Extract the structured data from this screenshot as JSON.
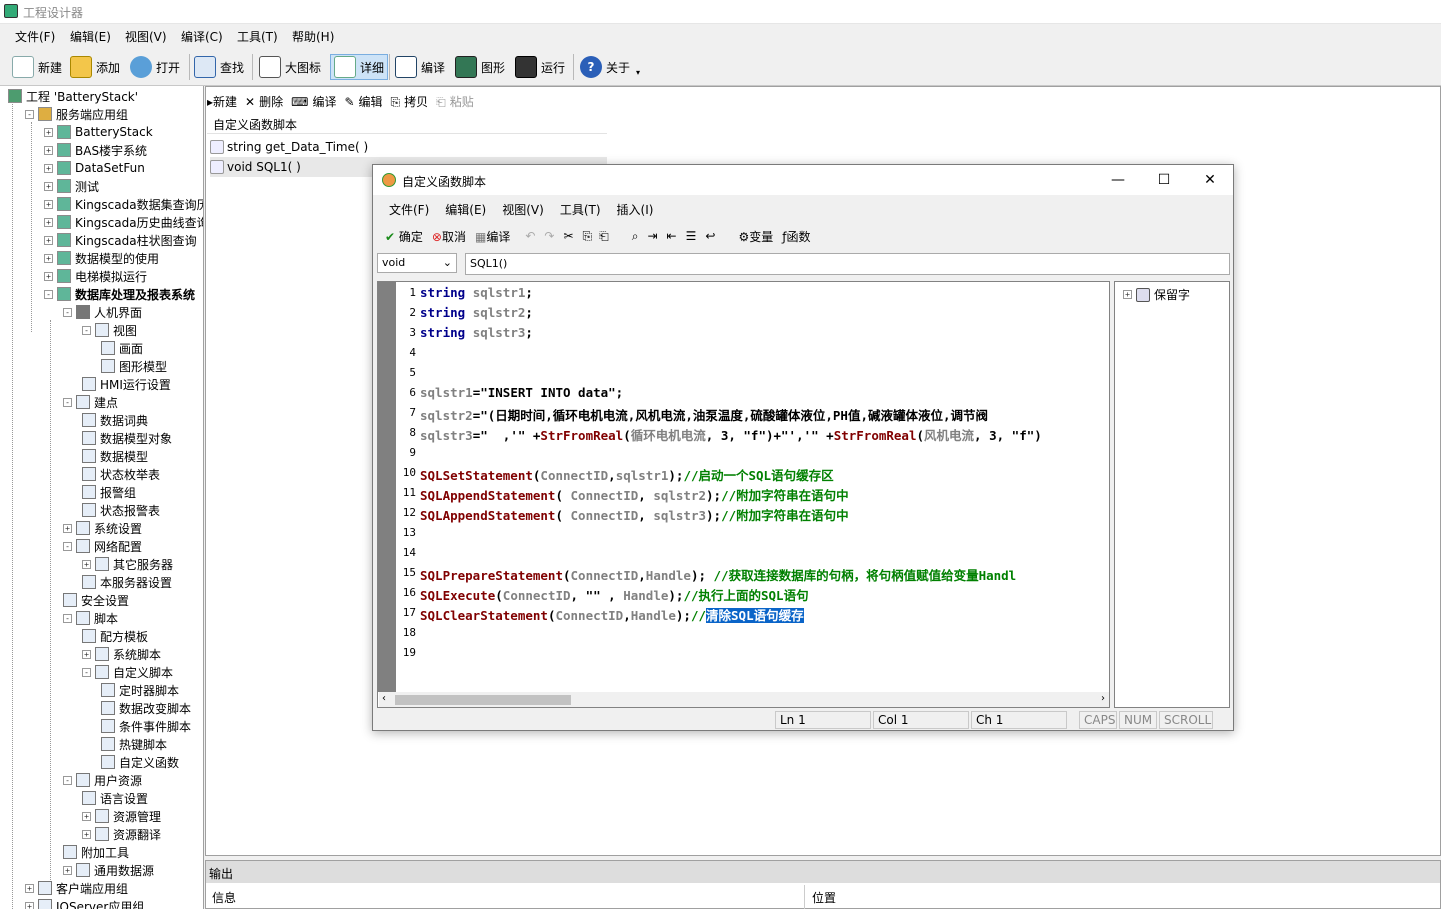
{
  "app": {
    "title": "工程设计器",
    "menus": [
      "文件(F)",
      "编辑(E)",
      "视图(V)",
      "编译(C)",
      "工具(T)",
      "帮助(H)"
    ],
    "toolbar": [
      "新建",
      "添加",
      "打开",
      "查找",
      "大图标",
      "详细",
      "编译",
      "图形",
      "运行",
      "关于"
    ]
  },
  "tree": [
    {
      "label": "工程 'BatteryStack'",
      "icon": "project-icon"
    },
    {
      "label": "服务端应用组",
      "icon": "server-group-icon"
    },
    {
      "label": "BatteryStack",
      "icon": "app-icon"
    },
    {
      "label": "BAS楼宇系统",
      "icon": "app-icon"
    },
    {
      "label": "DataSetFun",
      "icon": "app-icon"
    },
    {
      "label": "测试",
      "icon": "app-icon"
    },
    {
      "label": "Kingscada数据集查询历史",
      "icon": "app-icon"
    },
    {
      "label": "Kingscada历史曲线查询",
      "icon": "app-icon"
    },
    {
      "label": "Kingscada柱状图查询",
      "icon": "app-icon"
    },
    {
      "label": "数据模型的使用",
      "icon": "app-icon"
    },
    {
      "label": "电梯模拟运行",
      "icon": "app-icon"
    },
    {
      "label": "数据库处理及报表系统",
      "icon": "app-icon"
    },
    {
      "label": "人机界面",
      "icon": "hmi-icon"
    },
    {
      "label": "视图",
      "icon": "view-icon"
    },
    {
      "label": "画面",
      "icon": "screen-icon"
    },
    {
      "label": "图形模型",
      "icon": "graphic-model-icon"
    },
    {
      "label": "HMI运行设置",
      "icon": "settings-icon"
    },
    {
      "label": "建点",
      "icon": "tag-icon"
    },
    {
      "label": "数据词典",
      "icon": "dictionary-icon"
    },
    {
      "label": "数据模型对象",
      "icon": "model-object-icon"
    },
    {
      "label": "数据模型",
      "icon": "model-icon"
    },
    {
      "label": "状态枚举表",
      "icon": "enum-icon"
    },
    {
      "label": "报警组",
      "icon": "alarm-group-icon"
    },
    {
      "label": "状态报警表",
      "icon": "alarm-table-icon"
    },
    {
      "label": "系统设置",
      "icon": "system-settings-icon"
    },
    {
      "label": "网络配置",
      "icon": "network-icon"
    },
    {
      "label": "其它服务器",
      "icon": "server-icon"
    },
    {
      "label": "本服务器设置",
      "icon": "server-settings-icon"
    },
    {
      "label": "安全设置",
      "icon": "lock-icon"
    },
    {
      "label": "脚本",
      "icon": "script-icon"
    },
    {
      "label": "配方模板",
      "icon": "recipe-icon"
    },
    {
      "label": "系统脚本",
      "icon": "script-icon"
    },
    {
      "label": "自定义脚本",
      "icon": "script-icon"
    },
    {
      "label": "定时器脚本",
      "icon": "script-icon"
    },
    {
      "label": "数据改变脚本",
      "icon": "script-icon"
    },
    {
      "label": "条件事件脚本",
      "icon": "script-icon"
    },
    {
      "label": "热键脚本",
      "icon": "script-icon"
    },
    {
      "label": "自定义函数",
      "icon": "script-icon"
    },
    {
      "label": "用户资源",
      "icon": "user-icon"
    },
    {
      "label": "语言设置",
      "icon": "language-icon"
    },
    {
      "label": "资源管理",
      "icon": "resource-icon"
    },
    {
      "label": "资源翻译",
      "icon": "translate-icon"
    },
    {
      "label": "附加工具",
      "icon": "tools-icon"
    },
    {
      "label": "通用数据源",
      "icon": "datasource-icon"
    },
    {
      "label": "客户端应用组",
      "icon": "client-group-icon"
    },
    {
      "label": "IOServer应用组",
      "icon": "io-group-icon"
    }
  ],
  "pane": {
    "sub_toolbar": [
      "新建",
      "删除",
      "编译",
      "编辑",
      "拷贝",
      "粘贴"
    ],
    "list_header": "自定义函数脚本",
    "items": [
      "string get_Data_Time( )",
      "void SQL1( )"
    ],
    "output_title": "输出",
    "output_cols": [
      "信息",
      "位置"
    ]
  },
  "dialog": {
    "title": "自定义函数脚本",
    "menus": [
      "文件(F)",
      "编辑(E)",
      "视图(V)",
      "工具(T)",
      "插入(I)"
    ],
    "toolbar": {
      "ok": "确定",
      "cancel": "取消",
      "compile": "编译",
      "var": "变量",
      "func": "函数"
    },
    "return_type": "void",
    "func_sig": "SQL1()",
    "side_root": "保留字",
    "status": {
      "ln": "Ln 1",
      "col": "Col 1",
      "ch": "Ch 1",
      "caps": "CAPS",
      "num": "NUM",
      "scroll": "SCROLL"
    },
    "lines": [
      [
        [
          "kw",
          "string "
        ],
        [
          "id",
          "sqlstr1"
        ],
        [
          "str",
          ";"
        ]
      ],
      [
        [
          "kw",
          "string "
        ],
        [
          "id",
          "sqlstr2"
        ],
        [
          "str",
          ";"
        ]
      ],
      [
        [
          "kw",
          "string "
        ],
        [
          "id",
          "sqlstr3"
        ],
        [
          "str",
          ";"
        ]
      ],
      [],
      [],
      [
        [
          "id",
          "sqlstr1"
        ],
        [
          "str",
          "=\"INSERT INTO data\";"
        ]
      ],
      [
        [
          "id",
          "sqlstr2"
        ],
        [
          "str",
          "=\"(日期时间,循环电机电流,风机电流,油泵温度,硫酸罐体液位,PH值,碱液罐体液位,调节阀"
        ]
      ],
      [
        [
          "id",
          "sqlstr3"
        ],
        [
          "str",
          "=\"  ,'\" +"
        ],
        [
          "fn",
          "StrFromReal"
        ],
        [
          "str",
          "("
        ],
        [
          "id",
          "循环电机电流"
        ],
        [
          "str",
          ", 3, \"f\")+\"','\" +"
        ],
        [
          "fn",
          "StrFromReal"
        ],
        [
          "str",
          "("
        ],
        [
          "id",
          "风机电流"
        ],
        [
          "str",
          ", 3, \"f\")"
        ]
      ],
      [],
      [
        [
          "fn",
          "SQLSetStatement"
        ],
        [
          "str",
          "("
        ],
        [
          "id",
          "ConnectID"
        ],
        [
          "str",
          ","
        ],
        [
          "id",
          "sqlstr1"
        ],
        [
          "str",
          ");"
        ],
        [
          "cm",
          "//启动一个SQL语句缓存区"
        ]
      ],
      [
        [
          "fn",
          "SQLAppendStatement"
        ],
        [
          "str",
          "( "
        ],
        [
          "id",
          "ConnectID"
        ],
        [
          "str",
          ", "
        ],
        [
          "id",
          "sqlstr2"
        ],
        [
          "str",
          ");"
        ],
        [
          "cm",
          "//附加字符串在语句中"
        ]
      ],
      [
        [
          "fn",
          "SQLAppendStatement"
        ],
        [
          "str",
          "( "
        ],
        [
          "id",
          "ConnectID"
        ],
        [
          "str",
          ", "
        ],
        [
          "id",
          "sqlstr3"
        ],
        [
          "str",
          ");"
        ],
        [
          "cm",
          "//附加字符串在语句中"
        ]
      ],
      [],
      [],
      [
        [
          "fn",
          "SQLPrepareStatement"
        ],
        [
          "str",
          "("
        ],
        [
          "id",
          "ConnectID"
        ],
        [
          "str",
          ","
        ],
        [
          "id",
          "Handle"
        ],
        [
          "str",
          "); "
        ],
        [
          "cm",
          "//获取连接数据库的句柄，将句柄值赋值给变量Handl"
        ]
      ],
      [
        [
          "fn",
          "SQLExecute"
        ],
        [
          "str",
          "("
        ],
        [
          "id",
          "ConnectID"
        ],
        [
          "str",
          ", \"\" , "
        ],
        [
          "id",
          "Handle"
        ],
        [
          "str",
          ");"
        ],
        [
          "cm",
          "//执行上面的SQL语句"
        ]
      ],
      [
        [
          "fn",
          "SQLClearStatement"
        ],
        [
          "str",
          "("
        ],
        [
          "id",
          "ConnectID"
        ],
        [
          "str",
          ","
        ],
        [
          "id",
          "Handle"
        ],
        [
          "str",
          ");"
        ],
        [
          "cm",
          "//"
        ],
        [
          "sel",
          "清除SQL语句缓存"
        ]
      ],
      [],
      []
    ]
  }
}
